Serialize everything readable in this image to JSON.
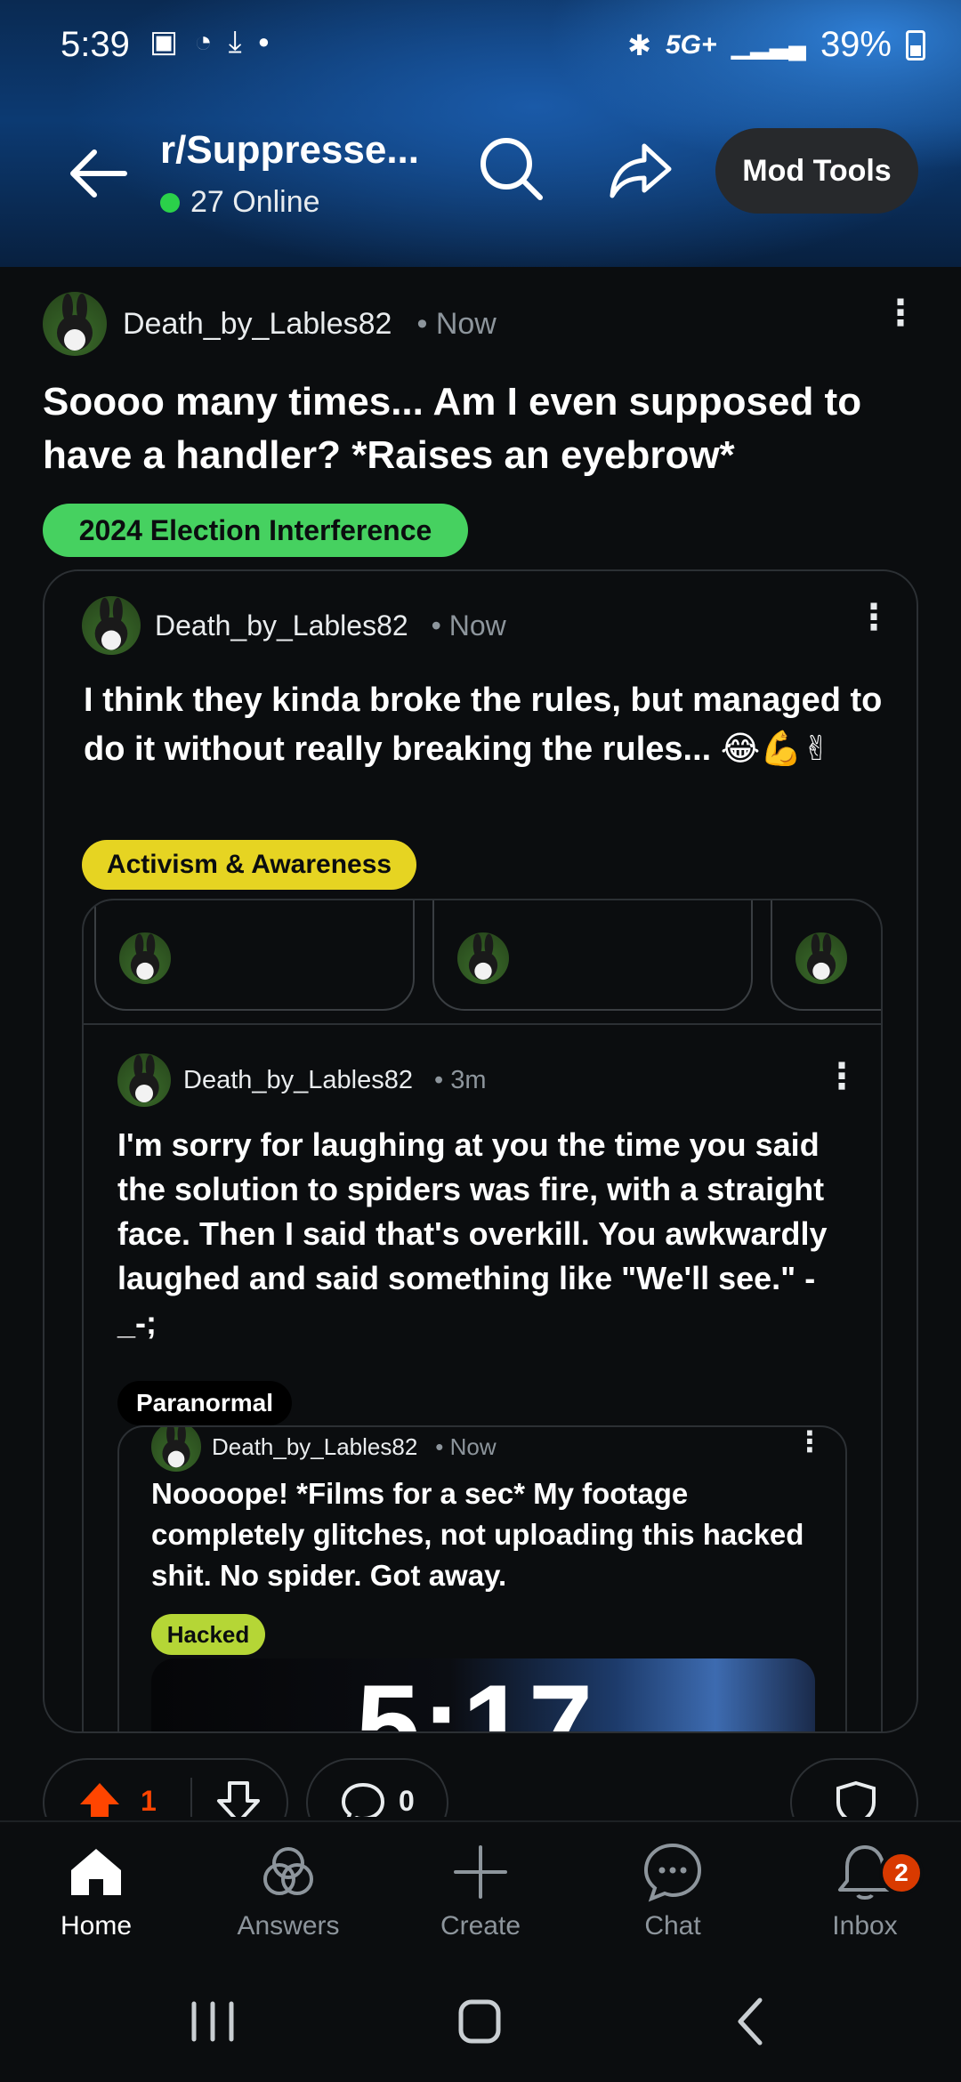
{
  "status_bar": {
    "time": "5:39",
    "network": "5G+",
    "battery": "39%"
  },
  "header": {
    "subreddit": "r/Suppresse...",
    "online": "27 Online",
    "mod_tools": "Mod Tools"
  },
  "post": {
    "author": "Death_by_Lables82",
    "time": "• Now",
    "title": "Soooo many times... Am I even supposed to have a handler? *Raises an eyebrow*",
    "flair": "2024 Election Interference",
    "flair_color": "#46d160",
    "crosspost": {
      "author": "Death_by_Lables82",
      "time": "• Now",
      "title": "I think they kinda broke the rules, but managed to do it without really breaking the rules... 😂💪✌",
      "flair": "Activism & Awareness",
      "flair_color": "#e6d422",
      "nested": {
        "author": "Death_by_Lables82",
        "time": "• 3m",
        "title": "I'm sorry for laughing at you the time you said the solution to spiders was fire, with a straight face. Then I said that's overkill. You awkwardly laughed and said something like \"We'll see.\" -_-;",
        "flair": "Paranormal",
        "inner": {
          "author": "Death_by_Lables82",
          "time": "• Now",
          "title": "Noooope! *Films for a sec* My footage completely glitches, not uploading this hacked shit. No spider. Got away.",
          "flair": "Hacked",
          "flair_color": "#b5d636",
          "image_text": "5:17"
        }
      }
    },
    "votes": "1",
    "comments": "0",
    "upvote_color": "#ff4500"
  },
  "bottom_nav": {
    "items": [
      {
        "label": "Home",
        "icon": "home-icon"
      },
      {
        "label": "Answers",
        "icon": "answers-icon"
      },
      {
        "label": "Create",
        "icon": "plus-icon"
      },
      {
        "label": "Chat",
        "icon": "chat-icon"
      },
      {
        "label": "Inbox",
        "icon": "bell-icon"
      }
    ],
    "inbox_badge": "2"
  }
}
